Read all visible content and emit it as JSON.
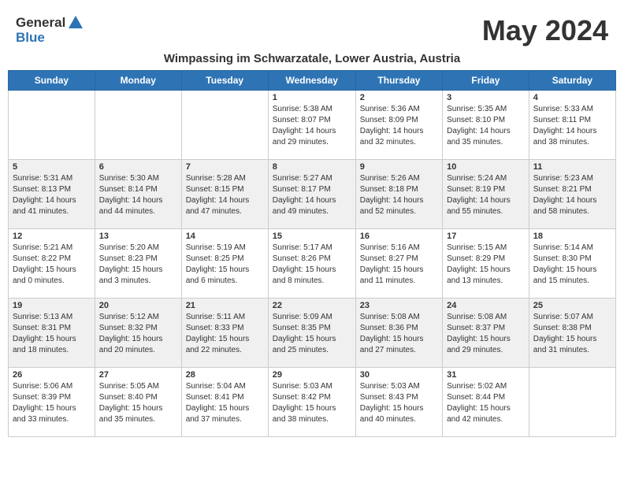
{
  "header": {
    "logo_general": "General",
    "logo_blue": "Blue",
    "month_title": "May 2024",
    "subtitle": "Wimpassing im Schwarzatale, Lower Austria, Austria"
  },
  "days_of_week": [
    "Sunday",
    "Monday",
    "Tuesday",
    "Wednesday",
    "Thursday",
    "Friday",
    "Saturday"
  ],
  "weeks": [
    {
      "row_class": "",
      "days": [
        {
          "num": "",
          "info": ""
        },
        {
          "num": "",
          "info": ""
        },
        {
          "num": "",
          "info": ""
        },
        {
          "num": "1",
          "info": "Sunrise: 5:38 AM\nSunset: 8:07 PM\nDaylight: 14 hours\nand 29 minutes."
        },
        {
          "num": "2",
          "info": "Sunrise: 5:36 AM\nSunset: 8:09 PM\nDaylight: 14 hours\nand 32 minutes."
        },
        {
          "num": "3",
          "info": "Sunrise: 5:35 AM\nSunset: 8:10 PM\nDaylight: 14 hours\nand 35 minutes."
        },
        {
          "num": "4",
          "info": "Sunrise: 5:33 AM\nSunset: 8:11 PM\nDaylight: 14 hours\nand 38 minutes."
        }
      ]
    },
    {
      "row_class": "alt-row",
      "days": [
        {
          "num": "5",
          "info": "Sunrise: 5:31 AM\nSunset: 8:13 PM\nDaylight: 14 hours\nand 41 minutes."
        },
        {
          "num": "6",
          "info": "Sunrise: 5:30 AM\nSunset: 8:14 PM\nDaylight: 14 hours\nand 44 minutes."
        },
        {
          "num": "7",
          "info": "Sunrise: 5:28 AM\nSunset: 8:15 PM\nDaylight: 14 hours\nand 47 minutes."
        },
        {
          "num": "8",
          "info": "Sunrise: 5:27 AM\nSunset: 8:17 PM\nDaylight: 14 hours\nand 49 minutes."
        },
        {
          "num": "9",
          "info": "Sunrise: 5:26 AM\nSunset: 8:18 PM\nDaylight: 14 hours\nand 52 minutes."
        },
        {
          "num": "10",
          "info": "Sunrise: 5:24 AM\nSunset: 8:19 PM\nDaylight: 14 hours\nand 55 minutes."
        },
        {
          "num": "11",
          "info": "Sunrise: 5:23 AM\nSunset: 8:21 PM\nDaylight: 14 hours\nand 58 minutes."
        }
      ]
    },
    {
      "row_class": "",
      "days": [
        {
          "num": "12",
          "info": "Sunrise: 5:21 AM\nSunset: 8:22 PM\nDaylight: 15 hours\nand 0 minutes."
        },
        {
          "num": "13",
          "info": "Sunrise: 5:20 AM\nSunset: 8:23 PM\nDaylight: 15 hours\nand 3 minutes."
        },
        {
          "num": "14",
          "info": "Sunrise: 5:19 AM\nSunset: 8:25 PM\nDaylight: 15 hours\nand 6 minutes."
        },
        {
          "num": "15",
          "info": "Sunrise: 5:17 AM\nSunset: 8:26 PM\nDaylight: 15 hours\nand 8 minutes."
        },
        {
          "num": "16",
          "info": "Sunrise: 5:16 AM\nSunset: 8:27 PM\nDaylight: 15 hours\nand 11 minutes."
        },
        {
          "num": "17",
          "info": "Sunrise: 5:15 AM\nSunset: 8:29 PM\nDaylight: 15 hours\nand 13 minutes."
        },
        {
          "num": "18",
          "info": "Sunrise: 5:14 AM\nSunset: 8:30 PM\nDaylight: 15 hours\nand 15 minutes."
        }
      ]
    },
    {
      "row_class": "alt-row",
      "days": [
        {
          "num": "19",
          "info": "Sunrise: 5:13 AM\nSunset: 8:31 PM\nDaylight: 15 hours\nand 18 minutes."
        },
        {
          "num": "20",
          "info": "Sunrise: 5:12 AM\nSunset: 8:32 PM\nDaylight: 15 hours\nand 20 minutes."
        },
        {
          "num": "21",
          "info": "Sunrise: 5:11 AM\nSunset: 8:33 PM\nDaylight: 15 hours\nand 22 minutes."
        },
        {
          "num": "22",
          "info": "Sunrise: 5:09 AM\nSunset: 8:35 PM\nDaylight: 15 hours\nand 25 minutes."
        },
        {
          "num": "23",
          "info": "Sunrise: 5:08 AM\nSunset: 8:36 PM\nDaylight: 15 hours\nand 27 minutes."
        },
        {
          "num": "24",
          "info": "Sunrise: 5:08 AM\nSunset: 8:37 PM\nDaylight: 15 hours\nand 29 minutes."
        },
        {
          "num": "25",
          "info": "Sunrise: 5:07 AM\nSunset: 8:38 PM\nDaylight: 15 hours\nand 31 minutes."
        }
      ]
    },
    {
      "row_class": "",
      "days": [
        {
          "num": "26",
          "info": "Sunrise: 5:06 AM\nSunset: 8:39 PM\nDaylight: 15 hours\nand 33 minutes."
        },
        {
          "num": "27",
          "info": "Sunrise: 5:05 AM\nSunset: 8:40 PM\nDaylight: 15 hours\nand 35 minutes."
        },
        {
          "num": "28",
          "info": "Sunrise: 5:04 AM\nSunset: 8:41 PM\nDaylight: 15 hours\nand 37 minutes."
        },
        {
          "num": "29",
          "info": "Sunrise: 5:03 AM\nSunset: 8:42 PM\nDaylight: 15 hours\nand 38 minutes."
        },
        {
          "num": "30",
          "info": "Sunrise: 5:03 AM\nSunset: 8:43 PM\nDaylight: 15 hours\nand 40 minutes."
        },
        {
          "num": "31",
          "info": "Sunrise: 5:02 AM\nSunset: 8:44 PM\nDaylight: 15 hours\nand 42 minutes."
        },
        {
          "num": "",
          "info": ""
        }
      ]
    }
  ]
}
